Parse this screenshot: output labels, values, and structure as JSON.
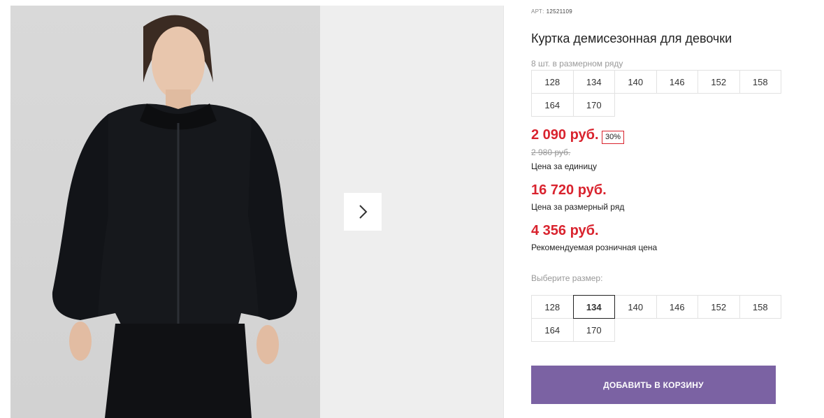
{
  "product": {
    "art_label": "АРТ:",
    "art_value": "12521109",
    "title": "Куртка демисезонная для девочки",
    "row_caption": "8 шт. в размерном ряду",
    "row_sizes": [
      "128",
      "134",
      "140",
      "146",
      "152",
      "158",
      "164",
      "170"
    ]
  },
  "pricing": {
    "unit_price": "2 090 руб.",
    "discount": "30%",
    "old_price": "2 980 руб.",
    "unit_label": "Цена за единицу",
    "row_price": "16 720 руб.",
    "row_label": "Цена за размерный ряд",
    "rrp_price": "4 356 руб.",
    "rrp_label": "Рекомендуемая розничная цена"
  },
  "size_select": {
    "caption": "Выберите размер:",
    "options": [
      "128",
      "134",
      "140",
      "146",
      "152",
      "158",
      "164",
      "170"
    ],
    "selected": "134"
  },
  "cart": {
    "button_label": "ДОБАВИТЬ В КОРЗИНУ"
  },
  "gallery": {
    "next_icon": "chevron-right-icon"
  },
  "colors": {
    "price_red": "#d9232e",
    "button_purple": "#7b62a3"
  }
}
